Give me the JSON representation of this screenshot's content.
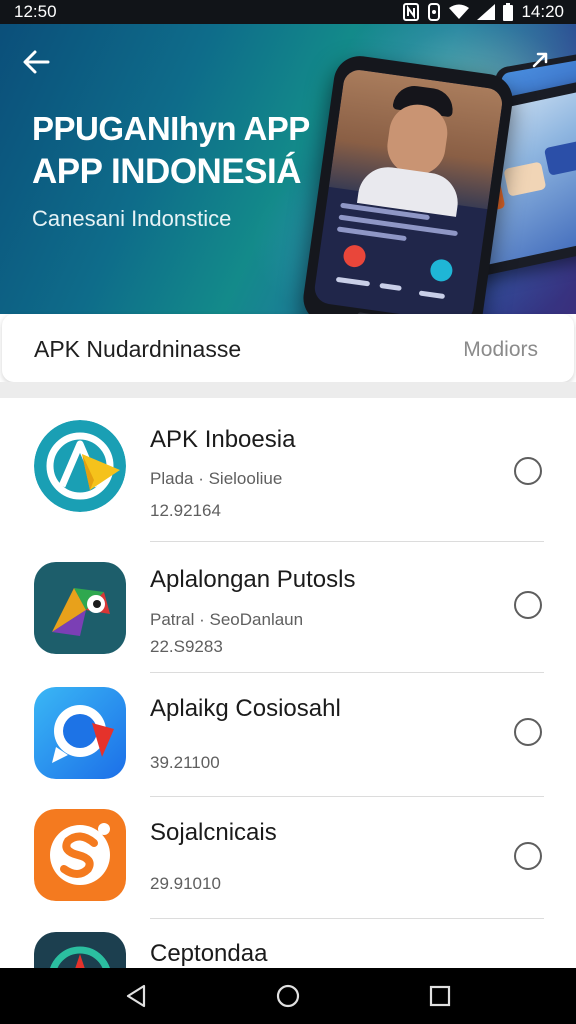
{
  "status_bar": {
    "left_text": "12:50",
    "time": "14:20",
    "icons": [
      "nfc-icon",
      "vibrate-icon",
      "wifi-icon",
      "signal-icon",
      "battery-icon"
    ]
  },
  "hero": {
    "title_line1": "PPUGANIhyn APP",
    "title_line2": "APP INDONESIÁ",
    "subtitle": "Canesani Indonstice",
    "colors": {
      "gradient_start": "#0b4f7a",
      "gradient_mid": "#138a8a",
      "gradient_end": "#3a2f7c"
    }
  },
  "search_card": {
    "label": "APK Nudardninasse",
    "action": "Modiors"
  },
  "apps": [
    {
      "name": "APK Inboesia",
      "meta": "Plada · Sielooliue",
      "version": "12.92164",
      "icon": "teal-a-arrow-icon"
    },
    {
      "name": "Aplalongan Putosls",
      "meta": "Patral · SeoDanlaun",
      "version": "22.S9283",
      "icon": "parrot-icon"
    },
    {
      "name": "Aplaikg Cosiosahl",
      "meta": "",
      "version": "39.21100",
      "icon": "chat-bubble-icon"
    },
    {
      "name": "Sojalcnicais",
      "meta": "",
      "version": "29.91010",
      "icon": "orange-s-icon"
    },
    {
      "name": "Ceptondaa",
      "meta": "",
      "version": "",
      "icon": "compass-icon"
    }
  ],
  "nav_bar": {
    "buttons": [
      "back-triangle-icon",
      "home-circle-icon",
      "recents-square-icon"
    ]
  },
  "colors": {
    "accent": "#138a8a",
    "text_primary": "#1b1b1b",
    "text_secondary": "#5f5f5f",
    "divider": "#dcdcdc"
  }
}
